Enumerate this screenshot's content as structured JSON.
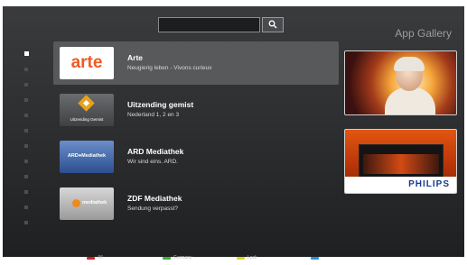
{
  "header": {
    "search_placeholder": "",
    "app_title": "App Gallery"
  },
  "sidebar": {
    "dots": [
      true,
      false,
      false,
      false,
      false,
      false,
      false,
      false,
      false,
      false,
      false,
      false
    ]
  },
  "apps": [
    {
      "name": "Arte",
      "description": "Neugierig leben - Vivons curieux",
      "logo_text": "arte",
      "selected": true
    },
    {
      "name": "Uitzending gemist",
      "description": "Nederland 1, 2 en 3",
      "logo_text": "Uitzending Gemist",
      "selected": false
    },
    {
      "name": "ARD Mediathek",
      "description": "Wir sind eins. ARD.",
      "logo_text": "ARD●Mediathek",
      "selected": false
    },
    {
      "name": "ZDF Mediathek",
      "description": "Sendung verpasst?",
      "logo_text": "mediathek",
      "selected": false
    }
  ],
  "featured": {
    "brand": "PHILIPS"
  },
  "color_keys": [
    {
      "color": "#d4242a",
      "label": "All"
    },
    {
      "color": "#3fae3a",
      "label": "Germany"
    },
    {
      "color": "#e2d21b",
      "label": "Lock"
    },
    {
      "color": "#2d8fd8",
      "label": ""
    }
  ]
}
